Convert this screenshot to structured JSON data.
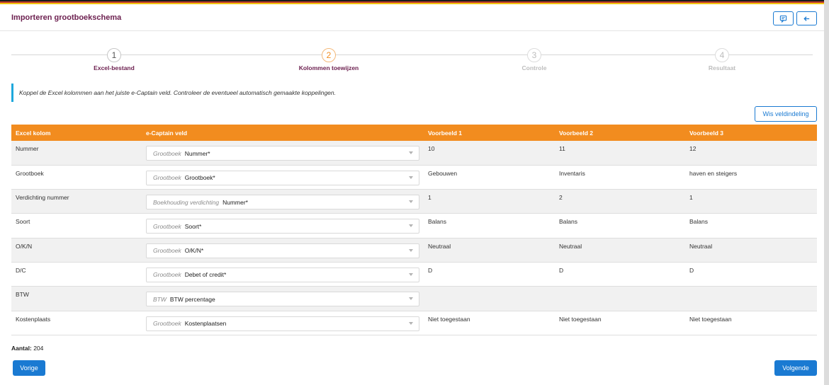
{
  "header": {
    "title": "Importeren grootboekschema"
  },
  "header_buttons": [
    {
      "icon": "comment-icon"
    },
    {
      "icon": "arrow-left-icon"
    }
  ],
  "steps": [
    {
      "number": "1",
      "label": "Excel-bestand",
      "state": "done"
    },
    {
      "number": "2",
      "label": "Kolommen toewijzen",
      "state": "active"
    },
    {
      "number": "3",
      "label": "Controle",
      "state": "disabled"
    },
    {
      "number": "4",
      "label": "Resultaat",
      "state": "disabled"
    }
  ],
  "info_text": "Koppel de Excel kolommen aan het juiste e-Captain veld. Controleer de eventueel automatisch gemaakte koppelingen.",
  "clear_button": "Wis veldindeling",
  "table": {
    "headers": [
      "Excel kolom",
      "e-Captain veld",
      "Voorbeeld 1",
      "Voorbeeld 2",
      "Voorbeeld 3"
    ],
    "rows": [
      {
        "excel": "Nummer",
        "hint": "Grootboek",
        "field": "Nummer*",
        "v1": "10",
        "v2": "11",
        "v3": "12"
      },
      {
        "excel": "Grootboek",
        "hint": "Grootboek",
        "field": "Grootboek*",
        "v1": "Gebouwen",
        "v2": "Inventaris",
        "v3": "haven en steigers"
      },
      {
        "excel": "Verdichting nummer",
        "hint": "Boekhouding verdichting",
        "field": "Nummer*",
        "v1": "1",
        "v2": "2",
        "v3": "1"
      },
      {
        "excel": "Soort",
        "hint": "Grootboek",
        "field": "Soort*",
        "v1": "Balans",
        "v2": "Balans",
        "v3": "Balans"
      },
      {
        "excel": "O/K/N",
        "hint": "Grootboek",
        "field": "O/K/N*",
        "v1": "Neutraal",
        "v2": "Neutraal",
        "v3": "Neutraal"
      },
      {
        "excel": "D/C",
        "hint": "Grootboek",
        "field": "Debet of credit*",
        "v1": "D",
        "v2": "D",
        "v3": "D"
      },
      {
        "excel": "BTW",
        "hint": "BTW",
        "field": "BTW percentage",
        "v1": "",
        "v2": "",
        "v3": ""
      },
      {
        "excel": "Kostenplaats",
        "hint": "Grootboek",
        "field": "Kostenplaatsen",
        "v1": "Niet toegestaan",
        "v2": "Niet toegestaan",
        "v3": "Niet toegestaan"
      }
    ]
  },
  "count": {
    "label": "Aantal:",
    "value": "204"
  },
  "footer": {
    "prev": "Vorige",
    "next": "Volgende"
  },
  "colors": {
    "accent": "#f28c1f",
    "primary": "#1a7ad2",
    "title": "#6d2150",
    "info_bar": "#1ea8dc"
  }
}
